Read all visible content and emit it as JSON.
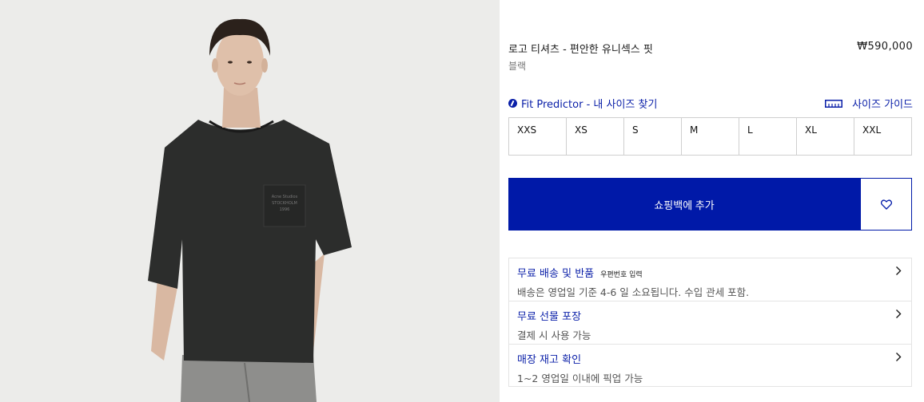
{
  "product": {
    "title": "로고 티셔츠 - 편안한 유니섹스 핏",
    "price": "₩590,000",
    "color": "블랙"
  },
  "fit_predictor": {
    "label": "Fit Predictor - 내 사이즈 찾기",
    "icon": "fit-predictor-icon"
  },
  "size_guide": {
    "label": "사이즈 가이드",
    "icon": "ruler-icon"
  },
  "sizes": [
    "XXS",
    "XS",
    "S",
    "M",
    "L",
    "XL",
    "XXL"
  ],
  "add_to_bag": {
    "label": "쇼핑백에 추가"
  },
  "wishlist": {
    "icon": "heart-icon"
  },
  "accordion": [
    {
      "title": "무료 배송 및 반품",
      "sub": "우편번호 입력",
      "desc": "배송은 영업일 기준 4-6 일 소요됩니다. 수입 관세 포함."
    },
    {
      "title": "무료 선물 포장",
      "sub": "",
      "desc": "결제 시 사용 가능"
    },
    {
      "title": "매장 재고 확인",
      "sub": "",
      "desc": "1~2 영업일 이내에 픽업 가능"
    }
  ],
  "colors": {
    "accent": "#0019a8",
    "link": "#0a1fa8",
    "photo_bg": "#ececea"
  }
}
